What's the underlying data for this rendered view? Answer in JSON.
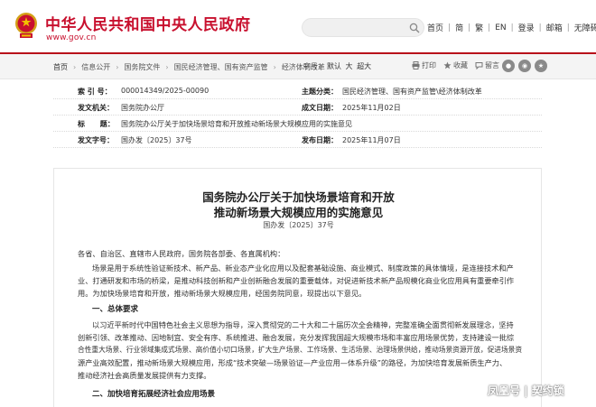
{
  "header": {
    "site_title": "中华人民共和国中央人民政府",
    "site_url": "www.gov.cn",
    "search_placeholder": "",
    "links": [
      "首页",
      "简",
      "繁",
      "EN",
      "登录",
      "邮箱",
      "无障碍"
    ]
  },
  "breadcrumb": {
    "items": [
      "首页",
      "信息公开",
      "国务院文件",
      "国民经济管理、国有资产监管",
      "经济体制改革"
    ],
    "font_label": "字号：",
    "font_sizes": [
      "默认",
      "大",
      "超大"
    ],
    "tools": [
      "打印",
      "收藏",
      "留言"
    ],
    "share_icons": [
      "wechat-icon",
      "weibo-icon",
      "qzone-icon"
    ]
  },
  "meta": {
    "index_label": "索 引 号：",
    "index_value": "000014349/2025-00090",
    "topic_label": "主题分类：",
    "topic_value": "国民经济管理、国有资产监管\\经济体制改革",
    "issuer_label": "发文机关：",
    "issuer_value": "国务院办公厅",
    "created_label": "成文日期：",
    "created_value": "2025年11月02日",
    "title_label": "标      题：",
    "title_value": "国务院办公厅关于加快场景培育和开放推动新场景大规模应用的实施意见",
    "docno_label": "发文字号：",
    "docno_value": "国办发〔2025〕37号",
    "published_label": "发布日期：",
    "published_value": "2025年11月07日"
  },
  "document": {
    "title_line1": "国务院办公厅关于加快场景培育和开放",
    "title_line2": "推动新场景大规模应用的实施意见",
    "number": "国办发〔2025〕37号",
    "salutation": "各省、自治区、直辖市人民政府，国务院各部委、各直属机构：",
    "para1_line1": "场景是用于系统性验证新技术、新产品、新业态产业化应用以及配套基础设施、商业模式、制度政策的具体情境，是连接技术和产",
    "para1_line2": "业、打通研发和市场的桥梁，是推动科技创新和产业创新融合发展的重要载体，对促进新技术新产品规模化商业化应用具有重要牵引作",
    "para1_line3": "用。为加快场景培育和开放，推动新场景大规模应用，经国务院同意，现提出以下意见。",
    "section1": "一、总体要求",
    "para2_line1": "以习近平新时代中国特色社会主义思想为指导，深入贯彻党的二十大和二十届历次全会精神，完整准确全面贯彻新发展理念，坚持",
    "para2_line2": "创新引领、改革推动、因地制宜、安全有序、系统推进、融合发展，充分发挥我国超大规模市场和丰富应用场景优势，支持建设一批综",
    "para2_line3": "合性重大场景、行业领域集成式场景、高价值小切口场景，扩大生产场景、工作场景、生活场景、治理场景供给，推动场景资源开放，促进场景资",
    "para2_line4": "源产业高效配置，推动新场景大规模应用，形成“技术突破—场景验证—产业应用—体系升级”的路径，为加快培育发展新质生产力、",
    "para2_line5": "推动经济社会高质量发展提供有力支撑。",
    "section2": "二、加快培育拓展经济社会应用场景"
  },
  "watermark": "凤凰号 | 契约锁"
}
